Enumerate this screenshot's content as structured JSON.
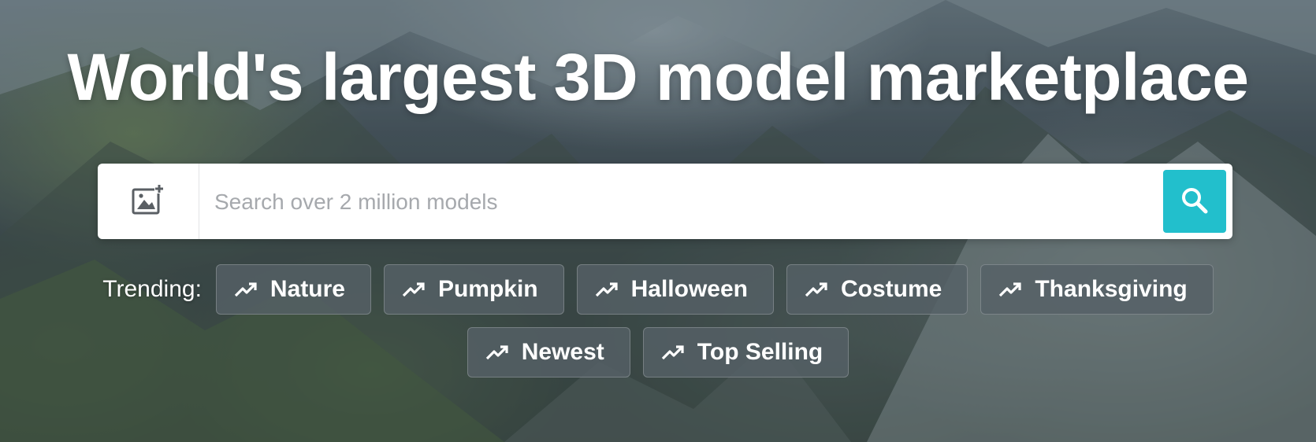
{
  "hero": {
    "title": "World's largest 3D model marketplace"
  },
  "search": {
    "placeholder": "Search over 2 million models",
    "image_search_icon": "image-plus-icon",
    "search_icon": "magnifier-icon",
    "search_button_color": "#22bfcc"
  },
  "trending": {
    "label": "Trending:",
    "chip_icon": "trending-up-icon",
    "chips_row1": [
      "Nature",
      "Pumpkin",
      "Halloween",
      "Costume",
      "Thanksgiving"
    ],
    "chips_row2": [
      "Newest",
      "Top Selling"
    ]
  }
}
